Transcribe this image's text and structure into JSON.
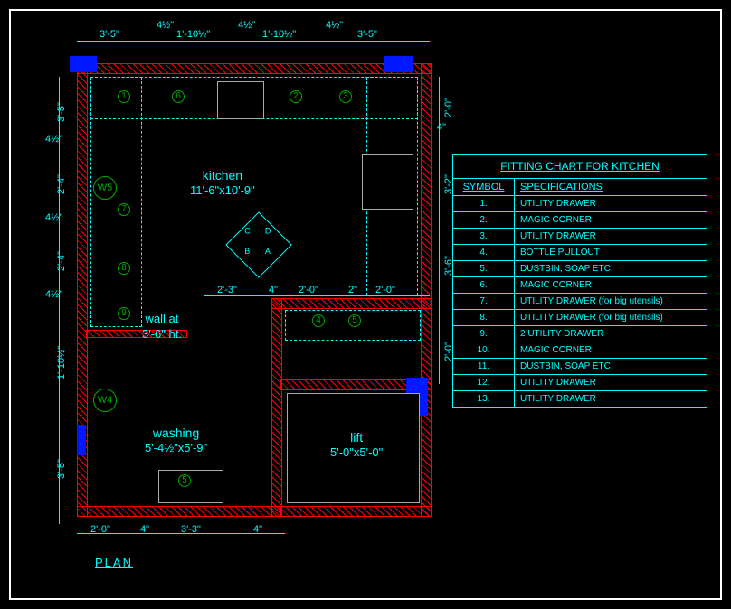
{
  "plan_title": "PLAN",
  "rooms": {
    "kitchen": {
      "name": "kitchen",
      "size": "11'-6\"x10'-9\""
    },
    "washing": {
      "name": "washing",
      "size": "5'-4½\"x5'-9\""
    },
    "lift": {
      "name": "lift",
      "size": "5'-0\"x5'-0\""
    },
    "wall_note_l1": "wall at",
    "wall_note_l2": "3'-6\" ht."
  },
  "windows": {
    "w4": "W4",
    "w5": "W5"
  },
  "compass": {
    "a": "A",
    "b": "B",
    "c": "C",
    "d": "D"
  },
  "dims": {
    "top1": "3'-5\"",
    "top2": "4½\"",
    "top3": "1'-10½\"",
    "top4": "4½\"",
    "top5": "1'-10½\"",
    "top6": "4½\"",
    "top7": "3'-5\"",
    "r1": "2'-0\"",
    "r2": "4\"",
    "r3": "3'-2\"",
    "r4": "3'-6\"",
    "r5": "2'-0\"",
    "l1": "3'-5\"",
    "l2": "4½\"",
    "l3": "2'-4\"",
    "l4": "4½\"",
    "l5": "2'-4\"",
    "l6": "4½\"",
    "l7": "1'-10½\"",
    "l8": "3'-5\"",
    "mid1": "2'-3\"",
    "mid2": "4\"",
    "mid3": "2'-0\"",
    "mid4": "2\"",
    "mid5": "2'-0\"",
    "bot1": "2'-0\"",
    "bot2": "4\"",
    "bot3": "3'-3\"",
    "bot4": "4\""
  },
  "fixture_labels": {
    "f1": "1",
    "f2": "2",
    "f3": "3",
    "f4": "4",
    "f5": "5",
    "f6": "6",
    "f7": "7",
    "f8": "8",
    "f9": "9"
  },
  "chart": {
    "title": "FITTING CHART FOR KITCHEN",
    "head_sym": "SYMBOL",
    "head_spec": "SPECIFICATIONS",
    "rows": [
      {
        "n": "1.",
        "s": "UTILITY DRAWER"
      },
      {
        "n": "2.",
        "s": "MAGIC CORNER"
      },
      {
        "n": "3.",
        "s": "UTILITY DRAWER"
      },
      {
        "n": "4.",
        "s": "BOTTLE PULLOUT"
      },
      {
        "n": "5.",
        "s": "DUSTBIN, SOAP ETC."
      },
      {
        "n": "6.",
        "s": "MAGIC CORNER"
      },
      {
        "n": "7.",
        "s": "UTILITY DRAWER (for big utensils)"
      },
      {
        "n": "8.",
        "s": "UTILITY DRAWER (for big utensils)"
      },
      {
        "n": "9.",
        "s": "2 UTILITY DRAWER"
      },
      {
        "n": "10.",
        "s": "MAGIC CORNER"
      },
      {
        "n": "11.",
        "s": "DUSTBIN, SOAP ETC."
      },
      {
        "n": "12.",
        "s": "UTILITY DRAWER"
      },
      {
        "n": "13.",
        "s": "UTILITY DRAWER"
      }
    ]
  }
}
